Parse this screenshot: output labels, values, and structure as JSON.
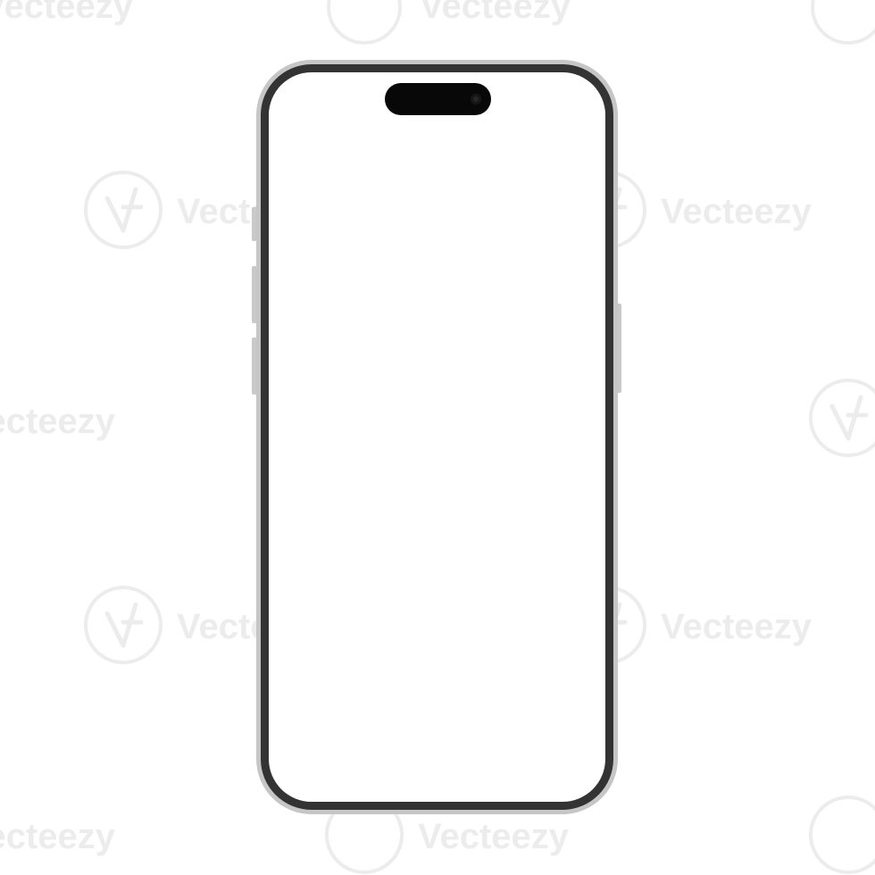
{
  "watermark": {
    "brand": "Vecteezy",
    "color": "#ececec"
  },
  "device": {
    "frame_color": "#c6c6c6",
    "bezel_color": "#333333",
    "screen_color": "#ffffff",
    "island_color": "#080808"
  }
}
